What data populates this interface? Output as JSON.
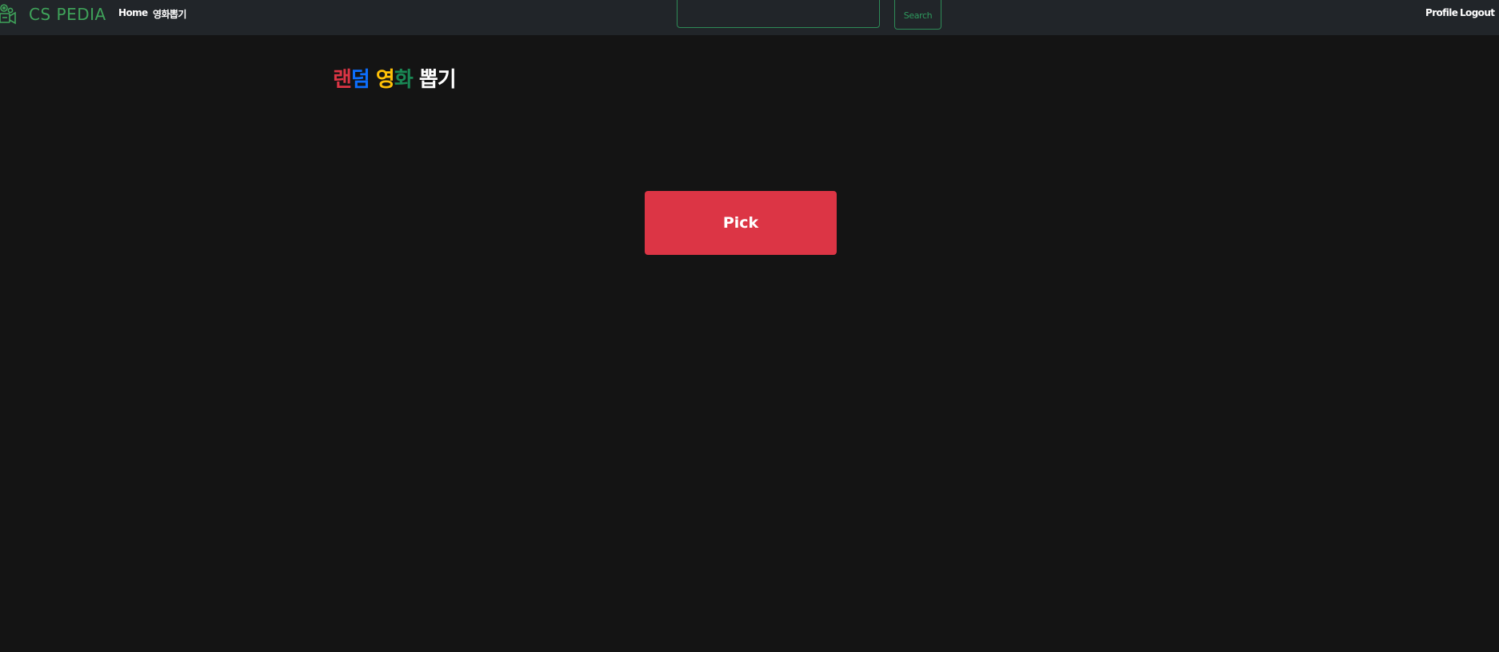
{
  "navbar": {
    "brand": {
      "icon": "movie-camera-icon",
      "title": "CS PEDIA",
      "color": "#3fa35a"
    },
    "links": [
      {
        "label": "Home"
      },
      {
        "label": "영화뽑기"
      }
    ],
    "search": {
      "placeholder": "",
      "value": "",
      "button_label": "Search",
      "accent": "#2e8b57"
    },
    "right_links": [
      {
        "label": "Profile"
      },
      {
        "label": "Logout"
      }
    ]
  },
  "main": {
    "title_parts": [
      {
        "text": "랜",
        "color": "#dc3545"
      },
      {
        "text": "덤",
        "color": "#0d6efd"
      },
      {
        "text": " ",
        "color": "#ffffff"
      },
      {
        "text": "영",
        "color": "#ffc107"
      },
      {
        "text": "화",
        "color": "#198754"
      },
      {
        "text": " ",
        "color": "#ffffff"
      },
      {
        "text": "뽑기",
        "color": "#ffffff"
      }
    ],
    "pick_button": {
      "label": "Pick",
      "color": "#dc3545"
    }
  },
  "colors": {
    "background": "#141414",
    "navbar": "#212529"
  }
}
